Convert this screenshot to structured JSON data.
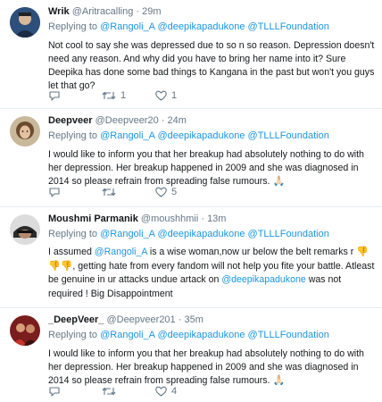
{
  "tweets": [
    {
      "name": "Wrik",
      "handle": "@Aritracalling",
      "time": "· 29m",
      "replying_prefix": "Replying to ",
      "replying_to": "@Rangoli_A @deepikapadukone @TLLLFoundation",
      "text": "Not cool to say she was depressed due to so n so reason. Depression doesn't need any reason. And why did you have to bring her name into it? Sure Deepika has done some bad things to Kangana in the past but won't you guys let that go?",
      "reply_count": "",
      "retweet_count": "1",
      "like_count": "1"
    },
    {
      "name": "Deepveer",
      "handle": "@Deepveer20",
      "time": "· 24m",
      "replying_prefix": "Replying to ",
      "replying_to": "@Rangoli_A @deepikapadukone @TLLLFoundation",
      "text": "I would like to inform you that her breakup had absolutely nothing to do with her depression. Her breakup happened in 2009 and she was diagnosed in 2014 so please refrain from spreading false rumours.",
      "emoji": "🙏🏻",
      "reply_count": "",
      "retweet_count": "",
      "like_count": "5"
    },
    {
      "name": "Moushmi Parmanik",
      "handle": "@moushhmii",
      "time": "· 13m",
      "replying_prefix": "Replying to ",
      "replying_to": "@Rangoli_A @deepikapadukone @TLLLFoundation",
      "text_1": "I assumed ",
      "mention_1": "@Rangoli_A",
      "text_2": " is a wise woman,now ur below the belt remarks r ",
      "emoji": "👎👎👎",
      "text_3": ", getting hate from every fandom will not help you fite your battle. Atleast be genuine in ur attacks undue artack on ",
      "mention_2": "@deepikapadukone",
      "text_4": " was not required ! Big Disappointment",
      "reply_count": "",
      "retweet_count": "",
      "like_count": ""
    },
    {
      "name": "_DeepVeer_",
      "handle": "@Deepveer201",
      "time": "· 35m",
      "replying_prefix": "Replying to ",
      "replying_to": "@Rangoli_A @deepikapadukone @TLLLFoundation",
      "text": "I would like to inform you that her breakup had absolutely nothing to do with her depression. Her breakup happened in 2009 and she was diagnosed in 2014 so please refrain from spreading false rumours.",
      "emoji": "🙏🏻",
      "reply_count": "",
      "retweet_count": "",
      "like_count": "4"
    }
  ]
}
